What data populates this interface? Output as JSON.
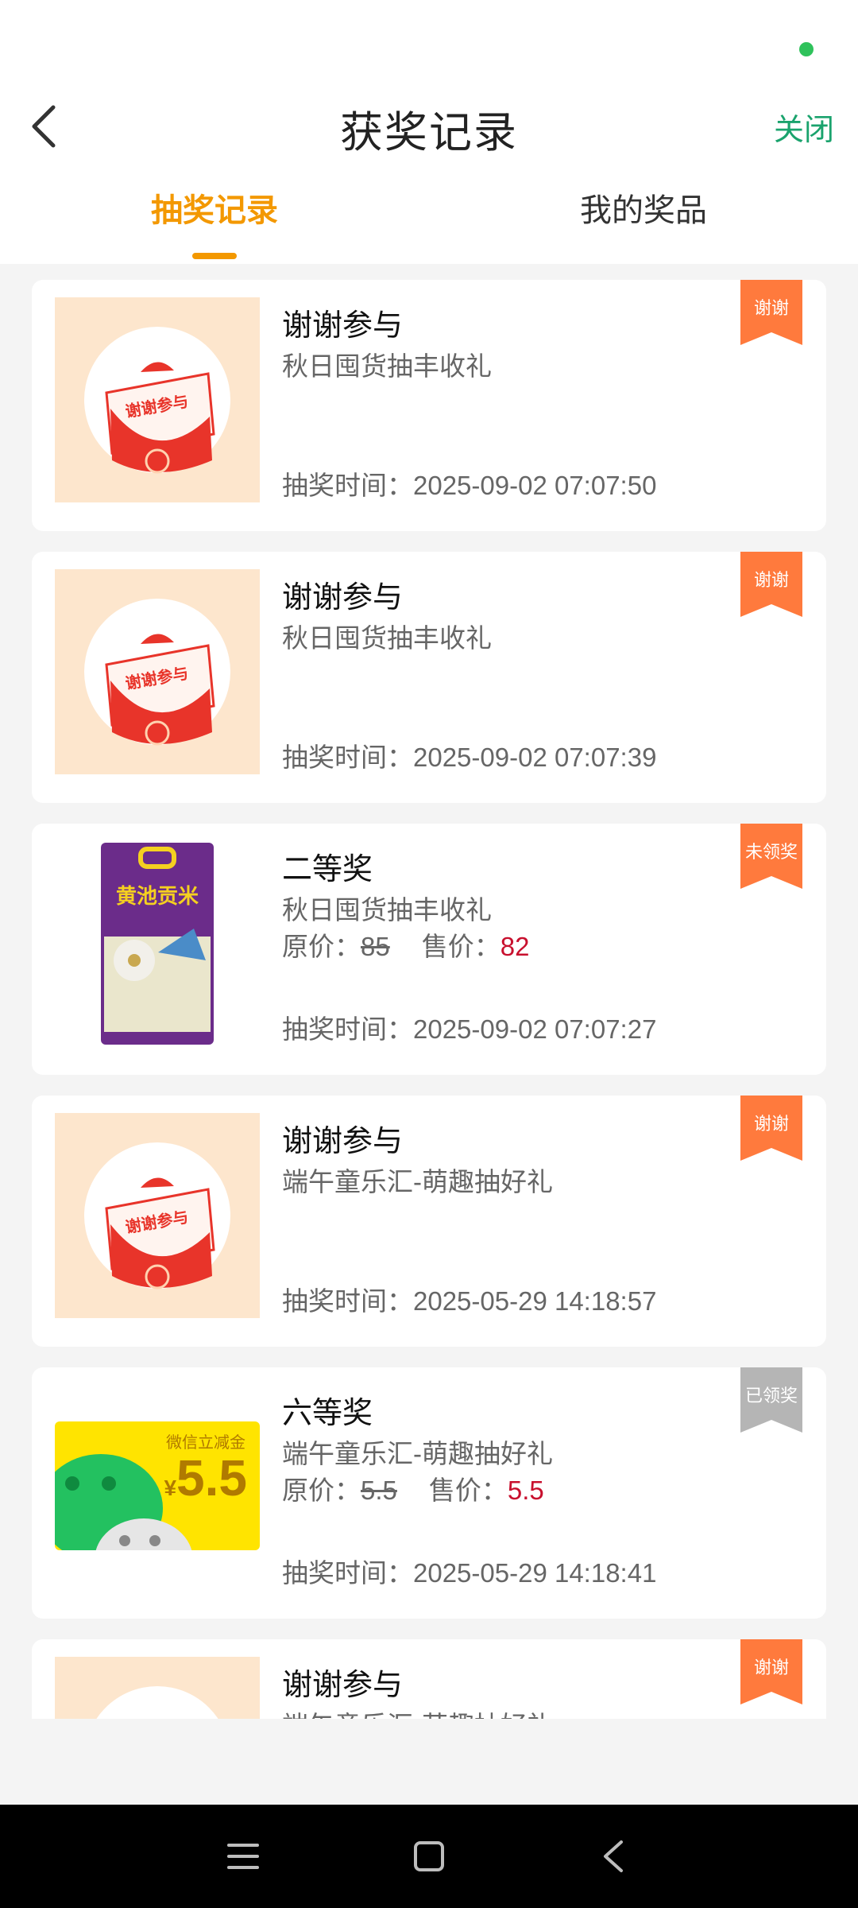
{
  "header": {
    "title": "获奖记录",
    "close_label": "关闭"
  },
  "tabs": [
    {
      "label": "抽奖记录",
      "active": true
    },
    {
      "label": "我的奖品",
      "active": false
    }
  ],
  "colors": {
    "accent": "#f39800",
    "close": "#1aa36d",
    "ribbon_orange": "#ff7a3d",
    "ribbon_gray": "#b5b5b5",
    "price_red": "#c8102e"
  },
  "records": [
    {
      "title": "谢谢参与",
      "activity": "秋日囤货抽丰收礼",
      "time": "抽奖时间：2025-09-02 07:07:50",
      "badge": "谢谢",
      "image": "thanks-participation-icon"
    },
    {
      "title": "谢谢参与",
      "activity": "秋日囤货抽丰收礼",
      "time": "抽奖时间：2025-09-02 07:07:39",
      "badge": "谢谢",
      "image": "thanks-participation-icon"
    },
    {
      "title": "二等奖",
      "activity": "秋日囤货抽丰收礼",
      "original_price_label": "原价：",
      "original_price": "85",
      "sale_price_label": "售价：",
      "sale_price": "82",
      "time": "抽奖时间：2025-09-02 07:07:27",
      "badge": "未领奖",
      "image": "rice-bag-image",
      "image_text": "黄池贡米"
    },
    {
      "title": "谢谢参与",
      "activity": "端午童乐汇-萌趣抽好礼",
      "time": "抽奖时间：2025-05-29 14:18:57",
      "badge": "谢谢",
      "image": "thanks-participation-icon"
    },
    {
      "title": "六等奖",
      "activity": "端午童乐汇-萌趣抽好礼",
      "original_price_label": "原价：",
      "original_price": "5.5",
      "sale_price_label": "售价：",
      "sale_price": "5.5",
      "time": "抽奖时间：2025-05-29 14:18:41",
      "badge": "已领奖",
      "image": "wechat-coupon-image",
      "image_caption": "微信立减金",
      "image_amount": "5.5"
    },
    {
      "title": "谢谢参与",
      "activity": "端午童乐汇-萌趣抽好礼",
      "badge": "谢谢",
      "image": "thanks-participation-icon"
    }
  ],
  "thanks_image_text": "谢谢参与"
}
